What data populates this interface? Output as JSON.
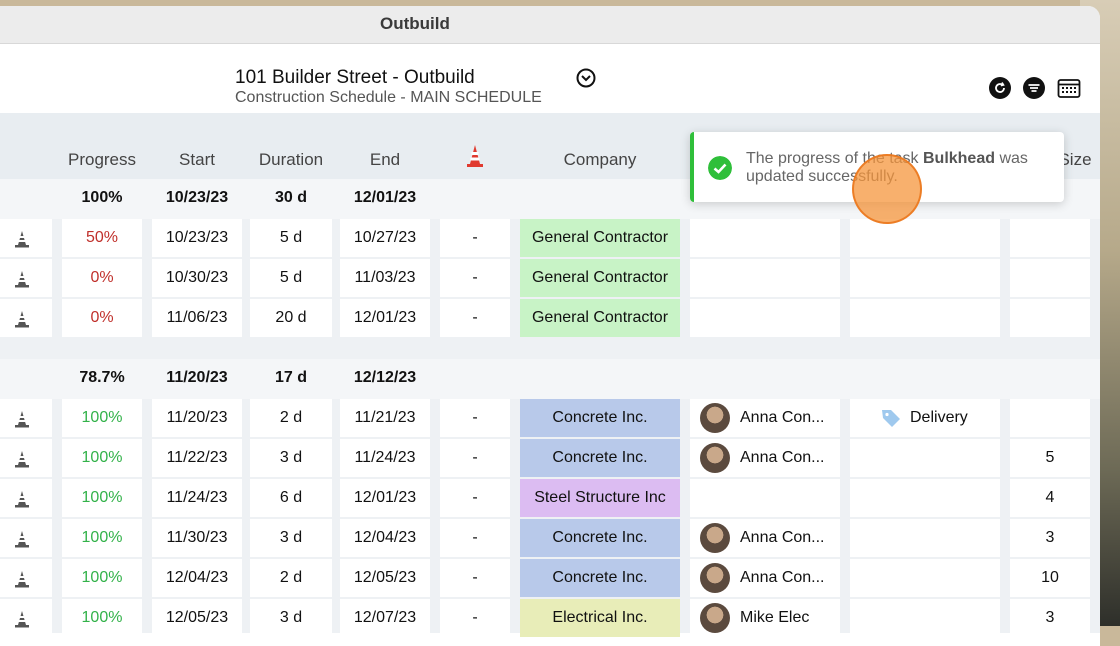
{
  "app": {
    "title": "Outbuild"
  },
  "header": {
    "project_title": "101 Builder Street - Outbuild",
    "schedule_subtitle": "Construction Schedule - MAIN SCHEDULE"
  },
  "columns": {
    "progress": "Progress",
    "start": "Start",
    "duration": "Duration",
    "end": "End",
    "company": "Company",
    "size": "Size"
  },
  "toast": {
    "prefix": "The progress of the task ",
    "task": "Bulkhead",
    "suffix": " was updated successfully."
  },
  "groups": [
    {
      "progress": "100%",
      "start": "10/23/23",
      "duration": "30 d",
      "end": "12/01/23"
    },
    {
      "progress": "78.7%",
      "start": "11/20/23",
      "duration": "17 d",
      "end": "12/12/23"
    }
  ],
  "rows": [
    {
      "progress": "50%",
      "start": "10/23/23",
      "duration": "5 d",
      "end": "10/27/23",
      "constraint": "-",
      "company": "General Contractor",
      "person": "",
      "tag": "",
      "size": ""
    },
    {
      "progress": "0%",
      "start": "10/30/23",
      "duration": "5 d",
      "end": "11/03/23",
      "constraint": "-",
      "company": "General Contractor",
      "person": "",
      "tag": "",
      "size": ""
    },
    {
      "progress": "0%",
      "start": "11/06/23",
      "duration": "20 d",
      "end": "12/01/23",
      "constraint": "-",
      "company": "General Contractor",
      "person": "",
      "tag": "",
      "size": ""
    },
    {
      "progress": "100%",
      "start": "11/20/23",
      "duration": "2 d",
      "end": "11/21/23",
      "constraint": "-",
      "company": "Concrete Inc.",
      "person": "Anna Con...",
      "tag": "Delivery",
      "size": ""
    },
    {
      "progress": "100%",
      "start": "11/22/23",
      "duration": "3 d",
      "end": "11/24/23",
      "constraint": "-",
      "company": "Concrete Inc.",
      "person": "Anna Con...",
      "tag": "",
      "size": "5"
    },
    {
      "progress": "100%",
      "start": "11/24/23",
      "duration": "6 d",
      "end": "12/01/23",
      "constraint": "-",
      "company": "Steel Structure Inc",
      "person": "",
      "tag": "",
      "size": "4"
    },
    {
      "progress": "100%",
      "start": "11/30/23",
      "duration": "3 d",
      "end": "12/04/23",
      "constraint": "-",
      "company": "Concrete Inc.",
      "person": "Anna Con...",
      "tag": "",
      "size": "3"
    },
    {
      "progress": "100%",
      "start": "12/04/23",
      "duration": "2 d",
      "end": "12/05/23",
      "constraint": "-",
      "company": "Concrete Inc.",
      "person": "Anna Con...",
      "tag": "",
      "size": "10"
    },
    {
      "progress": "100%",
      "start": "12/05/23",
      "duration": "3 d",
      "end": "12/07/23",
      "constraint": "-",
      "company": "Electrical Inc.",
      "person": "Mike Elec",
      "tag": "",
      "size": "3"
    }
  ],
  "colors": {
    "accent_green": "#33b24a",
    "alert_red": "#c0302b"
  }
}
